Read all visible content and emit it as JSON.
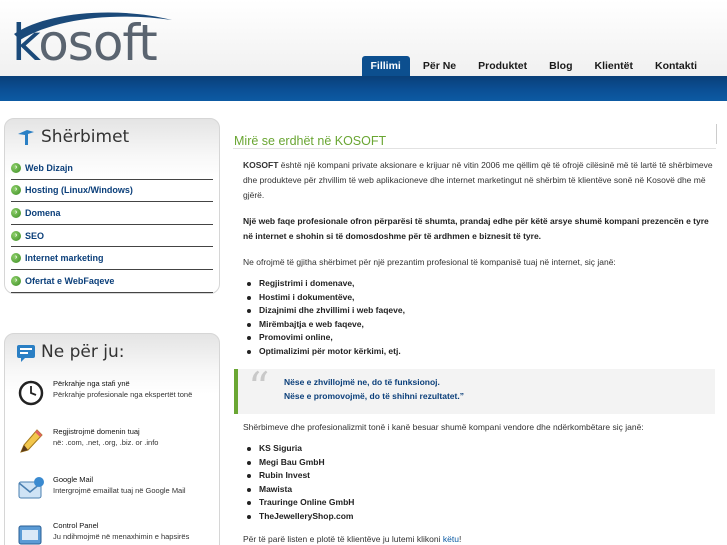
{
  "logo": {
    "text_k": "k",
    "text_rest": "osoft"
  },
  "nav": [
    {
      "label": "Fillimi",
      "active": true
    },
    {
      "label": "Për Ne",
      "active": false
    },
    {
      "label": "Produktet",
      "active": false
    },
    {
      "label": "Blog",
      "active": false
    },
    {
      "label": "Klientët",
      "active": false
    },
    {
      "label": "Kontakti",
      "active": false
    }
  ],
  "sidebar": {
    "services_title": "Shërbimet",
    "services": [
      "Web Dizajn",
      "Hosting (Linux/Windows)",
      "Domena",
      "SEO",
      "Internet marketing",
      "Ofertat e WebFaqeve"
    ],
    "for_you_title": "Ne për ju:",
    "features": [
      {
        "title": "Përkrahje nga stafi ynë",
        "desc": "Përkrahje profesionale nga ekspertët tonë",
        "icon": "clock-icon"
      },
      {
        "title": "Regjistrojmë domenin tuaj",
        "desc": "në: .com, .net, .org, .biz. or .info",
        "icon": "pencil-icon"
      },
      {
        "title": "Google Mail",
        "desc": "Intergrojmë emaillat tuaj në Google Mail",
        "icon": "mail-icon"
      },
      {
        "title": "Control Panel",
        "desc": "Ju ndihmojmë në menaxhimin e hapsirës",
        "icon": "control-panel-icon"
      }
    ]
  },
  "main": {
    "title": "Mirë se erdhët në KOSOFT",
    "intro_brand": "KOSOFT",
    "intro_rest": " është një kompani private aksionare e krijuar në vitin 2006 me qëllim që të ofrojë cilësinë më të lartë të shërbimeve dhe produkteve për zhvillim të web aplikacioneve dhe internet marketingut në shërbim të klientëve sonë në Kosovë dhe më gjërë.",
    "bold_para": "Një web faqe profesionale ofron përparësi të shumta, prandaj edhe për këtë arsye shumë kompani prezencën e tyre në internet e shohin si të domosdoshme për të ardhmen e biznesit të tyre.",
    "offer_para": "Ne ofrojmë të gjitha shërbimet për një prezantim profesional të kompanisë tuaj në internet, siç janë:",
    "offers": [
      "Regjistrimi i domenave,",
      "Hostimi i dokumentëve,",
      "Dizajnimi dhe zhvillimi i web faqeve,",
      "Mirëmbajtja e web faqeve,",
      "Promovimi online,",
      "Optimalizimi për motor kërkimi, etj."
    ],
    "quote_line1": "Nëse e zhvillojmë ne, do të funksionoj.",
    "quote_line2": "Nëse e promovojmë, do të shihni rezultatet.”",
    "clients_para": "Shërbimeve dhe profesionalizmit tonë i kanë besuar shumë kompani vendore dhe ndërkombëtare siç janë:",
    "clients": [
      "KS Siguria",
      "Megi Bau GmbH",
      "Rubin Invest",
      "Mawista",
      "Trauringe Online GmbH",
      "TheJewelleryShop.com"
    ],
    "footer_text": "Për të parë listen e plotë të klientëve ju lutemi klikoni ",
    "footer_link": "këtu",
    "footer_end": "!"
  }
}
